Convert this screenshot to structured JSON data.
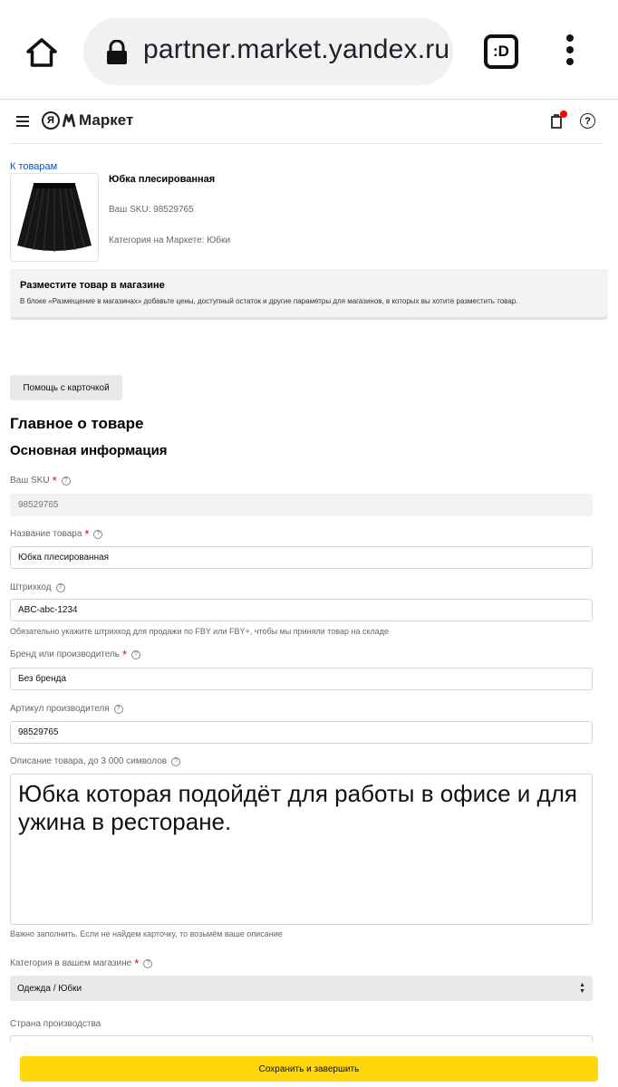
{
  "browser": {
    "url": "partner.market.yandex.ru",
    "tabs_label": ":D"
  },
  "header": {
    "logo_text": "Маркет",
    "logo_ya": "Я"
  },
  "product": {
    "back_link": "К товарам",
    "title": "Юбка плесированная",
    "sku_line": "Ваш SKU: 98529765",
    "category_line": "Категория на Маркете: Юбки"
  },
  "notice": {
    "title": "Разместите товар в магазине",
    "text": "В блоке «Размещение в магазинах» добавьте цены, доступный остаток и другие параметры для магазинов, в которых вы хотите разместить товар."
  },
  "help_button": "Помощь с карточкой",
  "section_title": "Главное о товаре",
  "subsection_title": "Основная информация",
  "fields": {
    "sku": {
      "label": "Ваш SKU",
      "value": "98529765"
    },
    "name": {
      "label": "Название товара",
      "value": "Юбка плесированная"
    },
    "barcode": {
      "label": "Штрихкод",
      "value": "ABC-abc-1234",
      "hint": "Обязательно укажите штрихкод для продажи по FBY или FBY+, чтобы мы приняли товар на складе"
    },
    "brand": {
      "label": "Бренд или производитель",
      "value": "Без бренда"
    },
    "article": {
      "label": "Артикул производителя",
      "value": "98529765"
    },
    "description": {
      "label": "Описание товара, до 3 000 символов",
      "value": "Юбка которая подойдёт для работы в офисе и для ужина в ресторане.",
      "hint": "Важно заполнить. Если не найдем карточку, то возьмём ваше описание"
    },
    "shop_category": {
      "label": "Категория в вашем магазине",
      "value": "Одежда / Юбки"
    },
    "country": {
      "label": "Страна производства"
    }
  },
  "save_button": "Сохранить и завершить",
  "colors": {
    "accent_yellow": "#ffd60a",
    "link_blue": "#1a4fa0",
    "required_red": "#e00000"
  }
}
